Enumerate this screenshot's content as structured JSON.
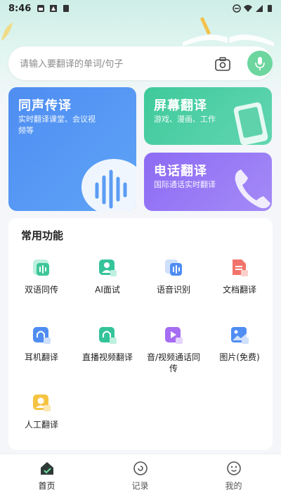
{
  "status_bar": {
    "time": "8:46"
  },
  "search": {
    "placeholder": "请输入要翻译的单词/句子",
    "value": ""
  },
  "cards": {
    "simultaneous": {
      "title": "同声传译",
      "subtitle": "实时翻译课堂、会议视频等"
    },
    "screen": {
      "title": "屏幕翻译",
      "subtitle": "游戏、漫画、工作"
    },
    "phone": {
      "title": "电话翻译",
      "subtitle": "国际通话实时翻译"
    }
  },
  "functions": {
    "title": "常用功能",
    "items": [
      {
        "label": "双语同传",
        "icon": "bilingual-icon",
        "color": "#3ec79a"
      },
      {
        "label": "AI面试",
        "icon": "ai-interview-icon",
        "color": "#35c39a"
      },
      {
        "label": "语音识别",
        "icon": "voice-recognition-icon",
        "color": "#4f8df2"
      },
      {
        "label": "文档翻译",
        "icon": "document-icon",
        "color": "#f2736b"
      },
      {
        "label": "耳机翻译",
        "icon": "earphone-icon",
        "color": "#4f8df2"
      },
      {
        "label": "直播视频翻译",
        "icon": "live-video-icon",
        "color": "#35c39a"
      },
      {
        "label": "音/视频通话同传",
        "icon": "av-call-icon",
        "color": "#a56df2"
      },
      {
        "label": "图片(免费)",
        "icon": "image-icon",
        "color": "#4f8df2"
      },
      {
        "label": "人工翻译",
        "icon": "human-translation-icon",
        "color": "#f5c443"
      }
    ]
  },
  "bottom_nav": [
    {
      "label": "首页",
      "icon": "home-icon",
      "active": true
    },
    {
      "label": "记录",
      "icon": "records-icon",
      "active": false
    },
    {
      "label": "我的",
      "icon": "profile-icon",
      "active": false
    }
  ],
  "colors": {
    "accent_green": "#6cd69e",
    "blue": "#4f8df2",
    "green": "#3fc99b",
    "purple": "#8d6bf4"
  }
}
